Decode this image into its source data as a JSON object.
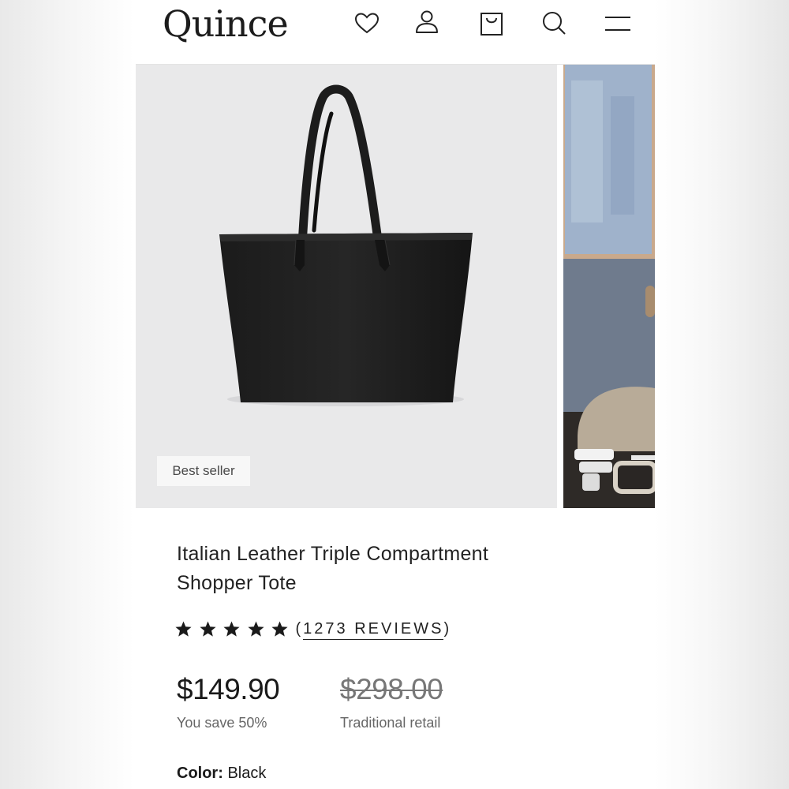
{
  "header": {
    "brand": "Quince",
    "icons": [
      "heart-icon",
      "user-icon",
      "bag-icon",
      "search-icon",
      "menu-icon"
    ]
  },
  "gallery": {
    "badge": "Best seller",
    "current_slide": 1
  },
  "product": {
    "title_line1": "Italian Leather Triple Compartment",
    "title_line2": "Shopper Tote",
    "rating": 5,
    "reviews_open": "(",
    "reviews_label": "1273 REVIEWS",
    "reviews_close": ")",
    "price": "$149.90",
    "savings": "You save 50%",
    "retail_price": "$298.00",
    "retail_label": "Traditional retail",
    "color_label": "Color:",
    "color_value": "Black"
  },
  "colors": {
    "star": "#1a1a1a",
    "text": "#222222",
    "muted": "#666666",
    "image_bg": "#e9e9ea"
  }
}
